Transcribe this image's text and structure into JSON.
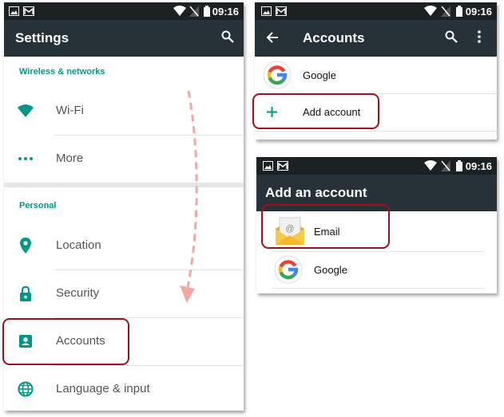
{
  "status": {
    "time": "09:16"
  },
  "settings": {
    "title": "Settings",
    "wireless_header": "Wireless & networks",
    "personal_header": "Personal",
    "items": [
      {
        "label": "Wi-Fi",
        "icon": "wifi-icon"
      },
      {
        "label": "More",
        "icon": "more-dots-icon"
      },
      {
        "label": "Location",
        "icon": "location-pin-icon"
      },
      {
        "label": "Security",
        "icon": "lock-icon"
      },
      {
        "label": "Accounts",
        "icon": "account-box-icon"
      },
      {
        "label": "Language & input",
        "icon": "globe-icon"
      }
    ]
  },
  "accounts": {
    "title": "Accounts",
    "items": [
      {
        "label": "Google",
        "icon": "google-logo-icon"
      },
      {
        "label": "Add account",
        "icon": "plus-icon"
      }
    ]
  },
  "add_account": {
    "title": "Add an account",
    "items": [
      {
        "label": "Email",
        "icon": "email-envelope-icon"
      },
      {
        "label": "Google",
        "icon": "google-logo-icon"
      }
    ]
  },
  "colors": {
    "status_bar": "#1c2124",
    "app_bar": "#263238",
    "accent_teal": "#009688",
    "highlight_red": "#a30f1c",
    "arrow_pink": "#f4a6a6"
  }
}
